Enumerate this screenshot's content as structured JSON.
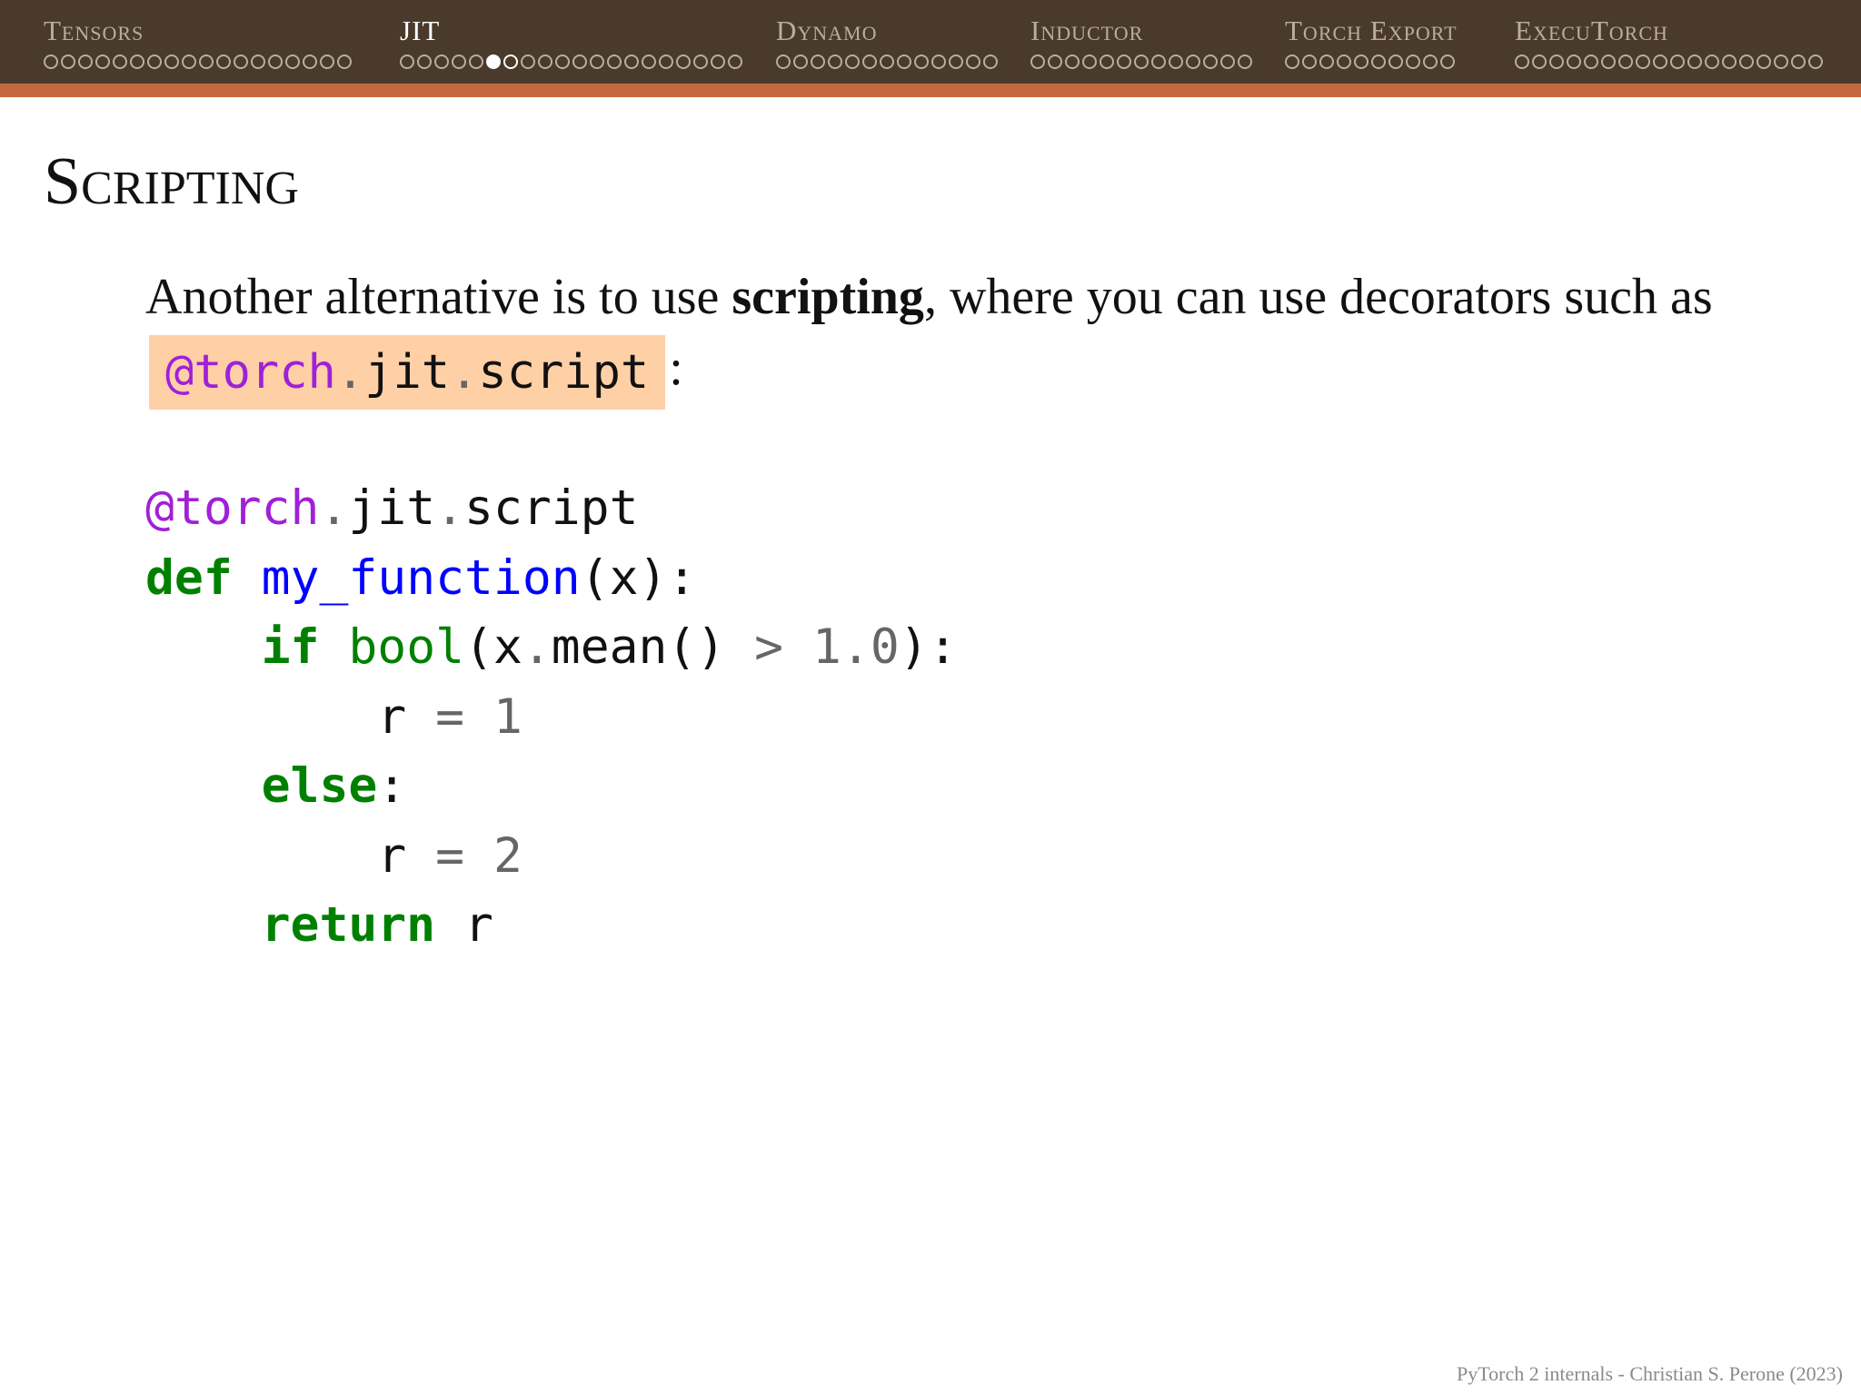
{
  "nav": {
    "sections": [
      {
        "label": "Tensors",
        "dots": 18,
        "active": false
      },
      {
        "label": "JIT",
        "dots": 20,
        "active": true,
        "filled_index": 5,
        "highlight_index": 6
      },
      {
        "label": "Dynamo",
        "dots": 13,
        "active": false
      },
      {
        "label": "Inductor",
        "dots": 13,
        "active": false
      },
      {
        "label": "Torch Export",
        "dots": 10,
        "active": false
      },
      {
        "label": "ExecuTorch",
        "dots": 18,
        "active": false
      }
    ],
    "bar_color": "#4a3a2c",
    "stripe_color": "#c4673f"
  },
  "slide": {
    "title": "Scripting",
    "intro_part1": "Another alternative is to use ",
    "intro_bold": "scripting",
    "intro_part2": ", where you can use decorators such as ",
    "inline_code": {
      "at": "@torch",
      "dot1": ".",
      "jit": "jit",
      "dot2": ".",
      "script": "script"
    },
    "intro_end": ":",
    "code": {
      "l1": {
        "dec": "@torch",
        "dot1": ".",
        "jit": "jit",
        "dot2": ".",
        "script": "script"
      },
      "l2": {
        "kw": "def",
        "sp": " ",
        "fn": "my_function",
        "rest": "(x):"
      },
      "l3": {
        "indent": "    ",
        "kw": "if",
        "sp": " ",
        "builtin": "bool",
        "p1": "(x",
        "dot": ".",
        "p2": "mean() ",
        "op": ">",
        "sp2": " ",
        "num": "1.0",
        "p3": "):"
      },
      "l4": {
        "indent": "        ",
        "var": "r ",
        "op": "=",
        "sp": " ",
        "num": "1"
      },
      "l5": {
        "indent": "    ",
        "kw": "else",
        "p": ":"
      },
      "l6": {
        "indent": "        ",
        "var": "r ",
        "op": "=",
        "sp": " ",
        "num": "2"
      },
      "l7": {
        "indent": "    ",
        "kw": "return",
        "rest": " r"
      }
    },
    "footer": "PyTorch 2 internals - Christian S. Perone (2023)"
  }
}
